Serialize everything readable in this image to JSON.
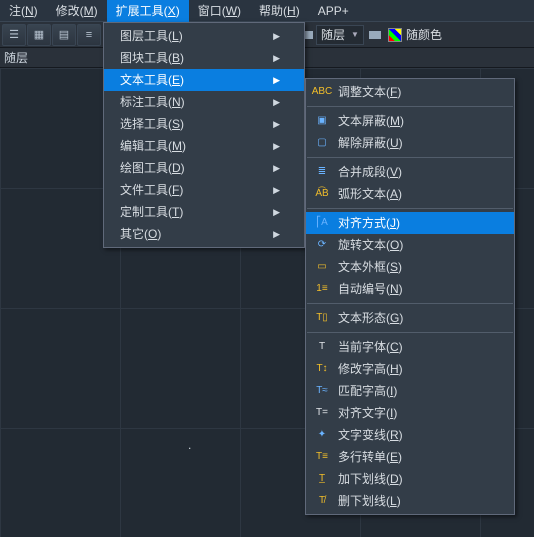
{
  "menubar": {
    "items": [
      {
        "label": "注",
        "key": "N"
      },
      {
        "label": "修改",
        "key": "M"
      },
      {
        "label": "扩展工具",
        "key": "X",
        "active": true
      },
      {
        "label": "窗口",
        "key": "W"
      },
      {
        "label": "帮助",
        "key": "H"
      },
      {
        "label": "APP+",
        "key": ""
      }
    ]
  },
  "toolbar": {
    "layer_dd": "随层",
    "color_dd": "随颜色"
  },
  "layerstrip": {
    "label": "随层"
  },
  "menu1": {
    "items": [
      {
        "label": "图层工具",
        "key": "L",
        "arrow": true
      },
      {
        "label": "图块工具",
        "key": "B",
        "arrow": true
      },
      {
        "label": "文本工具",
        "key": "E",
        "arrow": true,
        "highlight": true
      },
      {
        "label": "标注工具",
        "key": "N",
        "arrow": true
      },
      {
        "label": "选择工具",
        "key": "S",
        "arrow": true
      },
      {
        "label": "编辑工具",
        "key": "M",
        "arrow": true
      },
      {
        "label": "绘图工具",
        "key": "D",
        "arrow": true
      },
      {
        "label": "文件工具",
        "key": "F",
        "arrow": true
      },
      {
        "label": "定制工具",
        "key": "T",
        "arrow": true
      },
      {
        "label": "其它",
        "key": "O",
        "arrow": true
      }
    ]
  },
  "menu2": {
    "groups": [
      [
        {
          "ic": "abc-y",
          "label": "调整文本",
          "key": "F"
        }
      ],
      [
        {
          "ic": "mask",
          "label": "文本屏蔽",
          "key": "M"
        },
        {
          "ic": "unmask",
          "label": "解除屏蔽",
          "key": "U"
        }
      ],
      [
        {
          "ic": "merge",
          "label": "合并成段",
          "key": "V"
        },
        {
          "ic": "arc-y",
          "label": "弧形文本",
          "key": "A"
        }
      ],
      [
        {
          "ic": "align",
          "label": "对齐方式",
          "key": "J",
          "highlight": true
        },
        {
          "ic": "rotate",
          "label": "旋转文本",
          "key": "O"
        },
        {
          "ic": "border",
          "label": "文本外框",
          "key": "S"
        },
        {
          "ic": "autonum",
          "label": "自动编号",
          "key": "N"
        }
      ],
      [
        {
          "ic": "shape",
          "label": "文本形态",
          "key": "G"
        }
      ],
      [
        {
          "ic": "t",
          "label": "当前字体",
          "key": "C"
        },
        {
          "ic": "th",
          "label": "修改字高",
          "key": "H"
        },
        {
          "ic": "tm",
          "label": "匹配字高",
          "key": "I"
        },
        {
          "ic": "ta",
          "label": "对齐文字",
          "key": "I"
        },
        {
          "ic": "tv",
          "label": "文字变线",
          "key": "R"
        },
        {
          "ic": "ml",
          "label": "多行转单",
          "key": "E"
        },
        {
          "ic": "ul",
          "label": "加下划线",
          "key": "D"
        },
        {
          "ic": "nul",
          "label": "删下划线",
          "key": "L"
        }
      ]
    ]
  }
}
